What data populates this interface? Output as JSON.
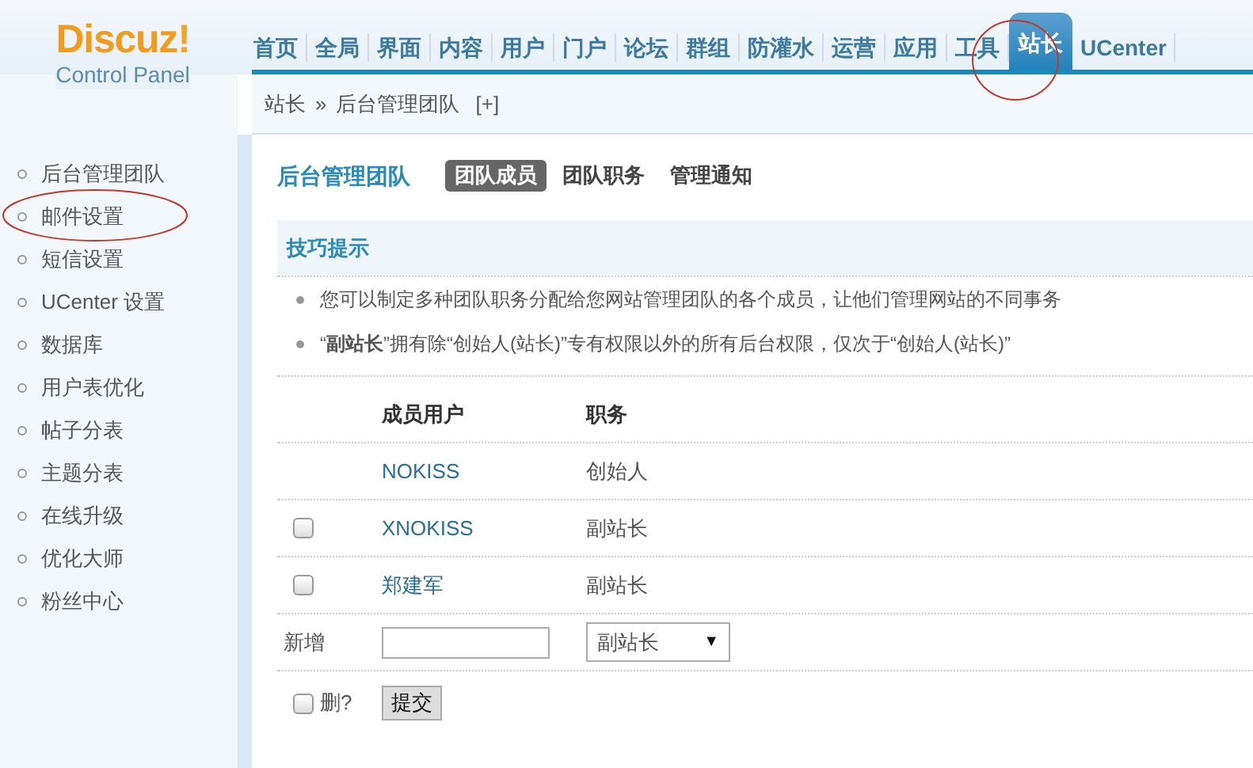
{
  "logo": {
    "title": "Discuz",
    "mark": "!",
    "subtitle": "Control Panel"
  },
  "nav": [
    {
      "label": "首页",
      "selected": false
    },
    {
      "label": "全局",
      "selected": false
    },
    {
      "label": "界面",
      "selected": false
    },
    {
      "label": "内容",
      "selected": false
    },
    {
      "label": "用户",
      "selected": false
    },
    {
      "label": "门户",
      "selected": false
    },
    {
      "label": "论坛",
      "selected": false
    },
    {
      "label": "群组",
      "selected": false
    },
    {
      "label": "防灌水",
      "selected": false
    },
    {
      "label": "运营",
      "selected": false
    },
    {
      "label": "应用",
      "selected": false
    },
    {
      "label": "工具",
      "selected": false
    },
    {
      "label": "站长",
      "selected": true
    },
    {
      "label": "UCenter",
      "selected": false
    }
  ],
  "breadcrumb": {
    "items": [
      "站长",
      "后台管理团队"
    ],
    "separator": "»",
    "add": "[+]"
  },
  "sidebar": {
    "items": [
      {
        "label": "后台管理团队",
        "selected": false
      },
      {
        "label": "邮件设置",
        "selected": false
      },
      {
        "label": "短信设置",
        "selected": false
      },
      {
        "label": "UCenter 设置",
        "selected": false
      },
      {
        "label": "数据库",
        "selected": false
      },
      {
        "label": "用户表优化",
        "selected": false
      },
      {
        "label": "帖子分表",
        "selected": false
      },
      {
        "label": "主题分表",
        "selected": false
      },
      {
        "label": "在线升级",
        "selected": false
      },
      {
        "label": "优化大师",
        "selected": false
      },
      {
        "label": "粉丝中心",
        "selected": false
      }
    ]
  },
  "page": {
    "title": "后台管理团队",
    "tabs": [
      {
        "label": "团队成员",
        "selected": true
      },
      {
        "label": "团队职务",
        "selected": false
      },
      {
        "label": "管理通知",
        "selected": false
      }
    ]
  },
  "tips": {
    "title": "技巧提示",
    "items": [
      "您可以制定多种团队职务分配给您网站管理团队的各个成员，让他们管理网站的不同事务",
      "“**副站长**”拥有除“创始人(站长)”专有权限以外的所有后台权限，仅次于“创始人(站长)”"
    ]
  },
  "table": {
    "columns": [
      "成员用户",
      "职务"
    ],
    "rows": [
      {
        "user": "NOKISS",
        "role": "创始人",
        "kind": "founder"
      },
      {
        "user": "XNOKISS",
        "role": "副站长",
        "kind": "member",
        "checked": false
      },
      {
        "user": "郑建军",
        "role": "副站长",
        "kind": "member",
        "checked": false
      }
    ]
  },
  "add_row": {
    "label": "新增",
    "role": "副站长",
    "caret": "▼"
  },
  "footer": {
    "delete_label": "删?",
    "delete_checked": false,
    "submit": "提交"
  },
  "annotations": [
    {
      "kind": "circle"
    },
    {
      "kind": "circle"
    }
  ]
}
